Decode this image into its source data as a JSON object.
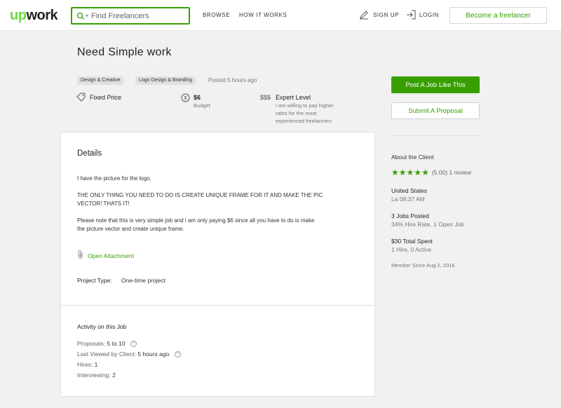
{
  "header": {
    "logo_up": "up",
    "logo_work": "work",
    "search_placeholder": "Find Freelancers",
    "nav_browse": "BROWSE",
    "nav_how": "HOW IT WORKS",
    "nav_signup": "SIGN UP",
    "nav_login": "LOGIN",
    "become_freelancer": "Become a freelancer"
  },
  "job": {
    "title": "Need Simple work",
    "tags": [
      "Design & Creative",
      "Logo Design & Branding"
    ],
    "posted": "Posted 5 hours ago",
    "price_type": "Fixed Price",
    "budget_value": "$6",
    "budget_label": "Budget",
    "level_symbol": "$$$",
    "level_label": "Expert Level",
    "level_desc_1": "I am willing to pay higher",
    "level_desc_2": "rates for the most",
    "level_desc_3": "experienced freelancers"
  },
  "actions": {
    "post_job": "Post A Job Like This",
    "submit_proposal": "Submit A Proposal"
  },
  "details": {
    "heading": "Details",
    "para1": "I have the picture for the logo.",
    "para2_line1": "THE ONLY THING YOU NEED TO DO IS CREATE UNIQUE FRAME FOR IT AND MAKE THE PIC",
    "para2_line2": "VECTOR! THATS IT!",
    "para3_line1": "Please note that this is very simple job and i am only paying $6 since all you have to do is make",
    "para3_line2": "the picture vector and create unique frame.",
    "attachment": "Open Attachment",
    "project_type_label": "Project Type:",
    "project_type_value": "One-time project"
  },
  "activity": {
    "heading": "Activity on this Job",
    "proposals_label": "Proposals:",
    "proposals_value": "5 to 10",
    "last_viewed_label": "Last Viewed by Client:",
    "last_viewed_value": "5 hours ago",
    "hires_label": "Hires:",
    "hires_value": "1",
    "interviewing_label": "Interviewing:",
    "interviewing_value": "2"
  },
  "client": {
    "heading": "About the Client",
    "rating_stars": 5,
    "rating_text": "(5.00) 1 review",
    "country": "United States",
    "local_time": "La 08:37 AM",
    "jobs_posted": "3 Jobs Posted",
    "hire_rate": "34% Hire Rate, 1 Open Job",
    "total_spent": "$30 Total Spent",
    "hires_active": "1 Hire, 0 Active",
    "member_since": "Member Since Aug 2, 2016"
  },
  "colors": {
    "brand_green": "#37a000",
    "logo_green": "#6fda44"
  }
}
